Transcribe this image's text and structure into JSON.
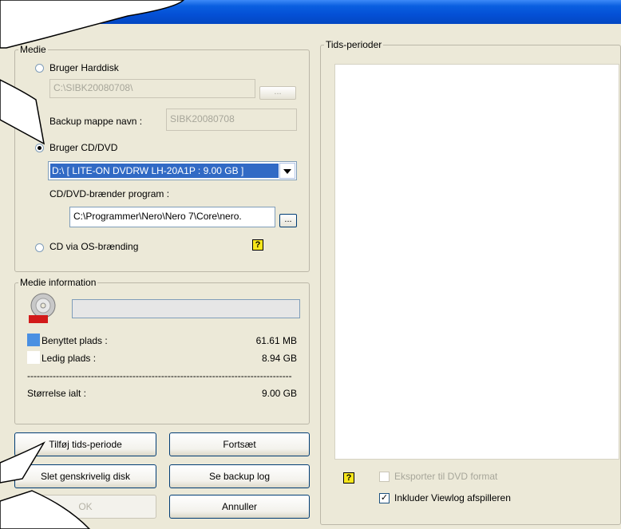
{
  "medie": {
    "title": "Medie",
    "radio_harddisk": "Bruger Harddisk",
    "harddisk_path": "C:\\SIBK20080708\\",
    "browse_label": "...",
    "backup_folder_label": "Backup mappe navn :",
    "backup_folder_value": "SIBK20080708",
    "radio_cddvd": "Bruger CD/DVD",
    "drive_selected": "D:\\ [ LITE-ON  DVDRW LH-20A1P   : 9.00 GB ]",
    "burner_label": "CD/DVD-brænder program :",
    "burner_path": "C:\\Programmer\\Nero\\Nero 7\\Core\\nero.",
    "radio_os": "CD via OS-brænding",
    "help_label": "?"
  },
  "info": {
    "title": "Medie information",
    "used_label": "Benyttet plads :",
    "used_value": "61.61 MB",
    "free_label": "Ledig plads :",
    "free_value": "8.94 GB",
    "separator": "-----------------------------------------------------------------------------------",
    "total_label": "Størrelse ialt :",
    "total_value": "9.00 GB",
    "progress_fraction": 0.0,
    "used_color": "#4a90e2",
    "free_color": "#ffffff"
  },
  "buttons": {
    "add_period": "Tilføj tids-periode",
    "continue": "Fortsæt",
    "delete_disk": "Slet genskrivelig disk",
    "view_log": "Se backup log",
    "ok": "OK",
    "cancel": "Annuller"
  },
  "periods": {
    "title": "Tids-perioder",
    "export_dvd": "Eksporter til DVD format",
    "include_viewlog": "Inkluder Viewlog afspilleren",
    "help_label": "?"
  }
}
